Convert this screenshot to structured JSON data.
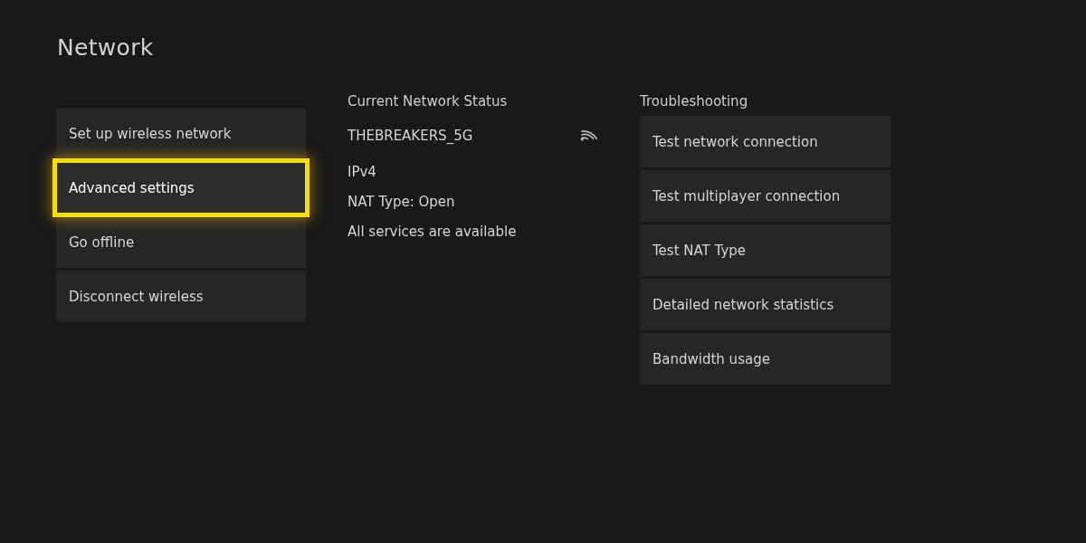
{
  "title": "Network",
  "menu": [
    {
      "label": "Set up wireless network",
      "selected": false
    },
    {
      "label": "Advanced settings",
      "selected": true
    },
    {
      "label": "Go offline",
      "selected": false
    },
    {
      "label": "Disconnect wireless",
      "selected": false
    }
  ],
  "status": {
    "heading": "Current Network Status",
    "network_name": "THEBREAKERS_5G",
    "lines": [
      "IPv4",
      "NAT Type: Open",
      "All services are available"
    ]
  },
  "troubleshooting": {
    "heading": "Troubleshooting",
    "items": [
      "Test network connection",
      "Test multiplayer connection",
      "Test NAT Type",
      "Detailed network statistics",
      "Bandwidth usage"
    ]
  }
}
